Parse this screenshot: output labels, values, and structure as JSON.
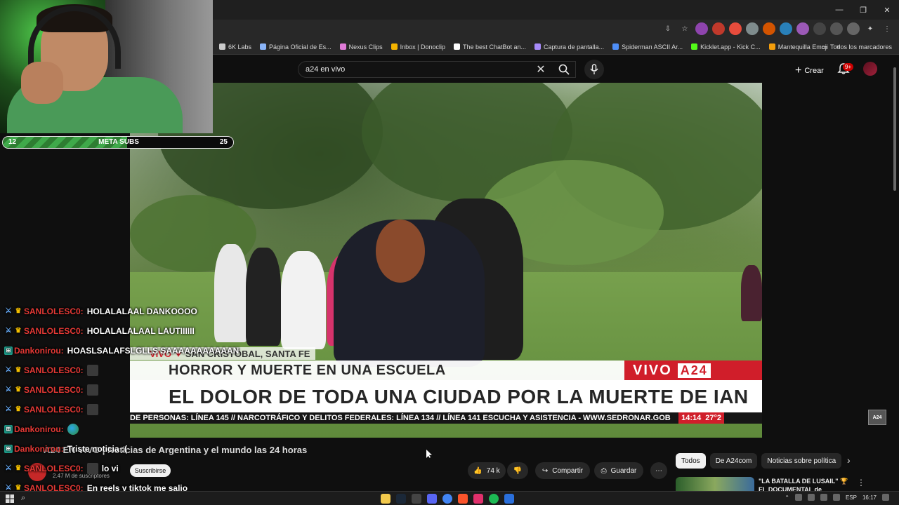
{
  "browser": {
    "window_controls": [
      "—",
      "❐",
      "✕"
    ],
    "bookmarks": [
      {
        "label": "6K Labs",
        "color": "#cccccc"
      },
      {
        "label": "Página Oficial de Es...",
        "color": "#8ab4f8"
      },
      {
        "label": "Nexus Clips",
        "color": "#e07bd8"
      },
      {
        "label": "Inbox | Donoclip",
        "color": "#f5b400"
      },
      {
        "label": "The best ChatBot an...",
        "color": "#ffffff"
      },
      {
        "label": "Captura de pantalla...",
        "color": "#a78bfa"
      },
      {
        "label": "Spiderman ASCII Ar...",
        "color": "#4e8ef7"
      },
      {
        "label": "Kicklet.app - Kick C...",
        "color": "#53fc18"
      },
      {
        "label": "Mantequilla Emoji",
        "color": "#f59e0b"
      }
    ],
    "bookmarks_more": "»",
    "all_bookmarks": "Todos los marcadores"
  },
  "youtube": {
    "search": {
      "value": "a24 en vivo",
      "clear_icon": "close-icon"
    },
    "create_label": "Crear",
    "notifications_count": "9+",
    "video": {
      "location_tag_vivo": "VIVO",
      "location_tag_place": "SAN CRISTÓBAL, SANTA FE",
      "headline_1": "HORROR Y MUERTE EN UNA ESCUELA",
      "headline_2": "EL DOLOR DE TODA UNA CIUDAD POR LA MUERTE DE IAN",
      "brand_vivo": "VIVO",
      "brand_a24": "A24",
      "ticker": "DE PERSONAS: LÍNEA 145 // NARCOTRÁFICO Y DELITOS FEDERALES: LÍNEA 134 // LÍNEA 141 ESCUCHA Y ASISTENCIA - WWW.SEDRONAR.GOB",
      "time": "14:14",
      "temp": "27°2",
      "corner_logo": "A24"
    },
    "title": "A24 EN VIVO | Noticias de Argentina y el mundo las 24 horas",
    "channel_subs": "2.47 M de suscriptores",
    "subscribe_label": "Suscribirse",
    "likes": "74 k",
    "share_label": "Compartir",
    "save_label": "Guardar",
    "chips": [
      "Todos",
      "De A24com",
      "Noticias sobre política"
    ],
    "recommended_title": "\"LA BATALLA DE LUSAIL\" 🏆 EL DOCUMENTAL de ARGENTINA"
  },
  "stream_overlay": {
    "meta_min": "12",
    "meta_label": "META SUBS",
    "meta_max": "25",
    "meta_progress": 0.54,
    "chat": [
      {
        "badges": [
          "mod",
          "crown"
        ],
        "user": "SANLOLESC0:",
        "message": "HOLALALAAL DANKOOOO"
      },
      {
        "badges": [
          "mod",
          "crown"
        ],
        "user": "SANLOLESC0:",
        "message": "HOLALALALAAL LAUTIIIIII"
      },
      {
        "badges": [
          "vip"
        ],
        "user": "Dankonirou:",
        "message": "HOASLSALAFSLGLLS SAAAAAAAAAAAN"
      },
      {
        "badges": [
          "mod",
          "crown"
        ],
        "user": "SANLOLESC0:",
        "message": "",
        "emote": true
      },
      {
        "badges": [
          "mod",
          "crown"
        ],
        "user": "SANLOLESC0:",
        "message": "",
        "emote": true
      },
      {
        "badges": [
          "mod",
          "crown"
        ],
        "user": "SANLOLESC0:",
        "message": "",
        "emote": true
      },
      {
        "badges": [
          "vip"
        ],
        "user": "Dankonirou:",
        "message": "",
        "globe": true
      },
      {
        "badges": [
          "vip"
        ],
        "user": "Dankonirou:",
        "message": "Triste noticia :("
      },
      {
        "badges": [
          "mod",
          "crown"
        ],
        "user": "SANLOLESC0:",
        "message": "lo vi",
        "emote": true
      },
      {
        "badges": [
          "mod",
          "crown"
        ],
        "user": "SANLOLESC0:",
        "message": "En reels y tiktok me salio"
      }
    ]
  },
  "taskbar": {
    "lang": "ESP",
    "clock": "16:17"
  }
}
